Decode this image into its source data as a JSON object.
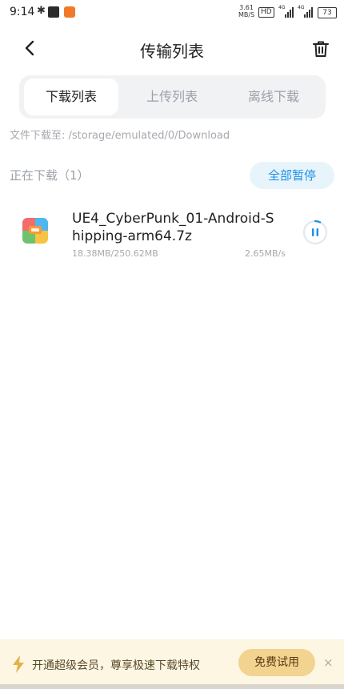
{
  "status_bar": {
    "time": "9:14",
    "net_speed": "3.61",
    "net_speed_unit": "MB/S",
    "hd_label": "HD",
    "signal1_label": "4G",
    "signal2_label": "4G",
    "battery": "73"
  },
  "header": {
    "title": "传输列表"
  },
  "tabs": [
    {
      "label": "下载列表",
      "active": true
    },
    {
      "label": "上传列表",
      "active": false
    },
    {
      "label": "离线下载",
      "active": false
    }
  ],
  "save_path": "文件下载至: /storage/emulated/0/Download",
  "section": {
    "label": "正在下载（1）",
    "pause_all": "全部暂停"
  },
  "downloads": [
    {
      "name": "UE4_CyberPunk_01-Android-Shipping-arm64.7z",
      "progress_text": "18.38MB/250.62MB",
      "speed": "2.65MB/s",
      "progress": 0.073,
      "icon": "archive-file-icon"
    }
  ],
  "vip_banner": {
    "text": "开通超级会员，尊享极速下载特权",
    "button": "免费试用",
    "close": "×"
  },
  "colors": {
    "accent": "#1a90e6",
    "vip_button": "#f2d38f",
    "banner_bg": "#fdf6e3"
  }
}
